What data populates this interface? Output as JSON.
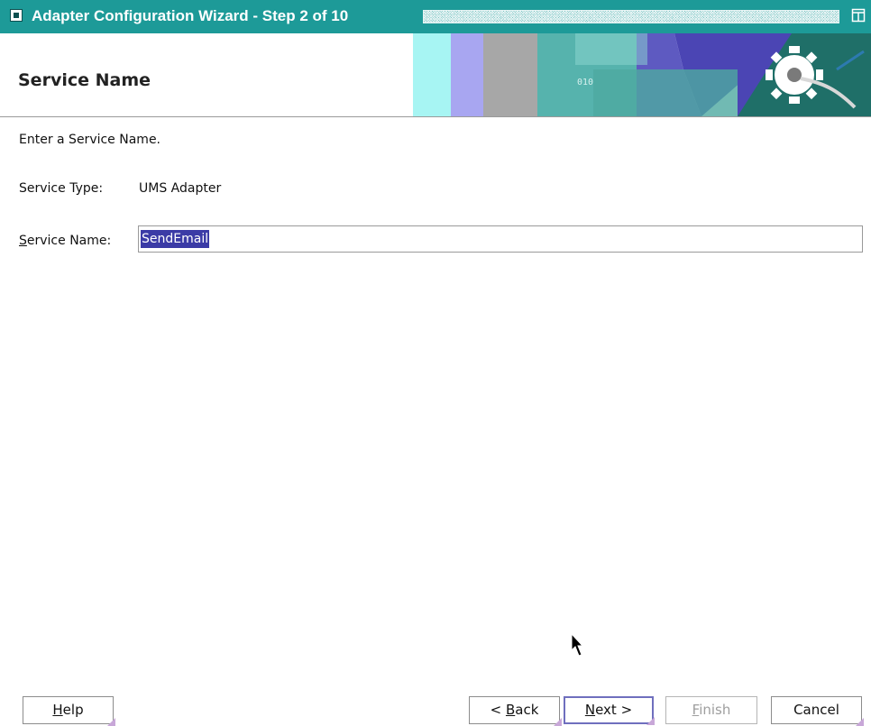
{
  "window": {
    "title": "Adapter Configuration Wizard - Step 2 of 10"
  },
  "header": {
    "page_title": "Service Name",
    "banner_text": "010"
  },
  "content": {
    "instruction": "Enter a Service Name.",
    "service_type": {
      "label": "Service Type:",
      "value": "UMS Adapter"
    },
    "service_name": {
      "label_mnemonic": "S",
      "label_rest": "ervice Name:",
      "value": "SendEmail"
    }
  },
  "buttons": {
    "help": {
      "mnemonic": "H",
      "rest": "elp"
    },
    "back": {
      "prefix": "< ",
      "mnemonic": "B",
      "rest": "ack"
    },
    "next": {
      "mnemonic": "N",
      "rest": "ext >"
    },
    "finish": {
      "mnemonic": "F",
      "rest": "inish"
    },
    "cancel": {
      "label": "Cancel"
    }
  },
  "colors": {
    "titlebar": "#1d9a98",
    "selection": "#3b3ba6",
    "default_button_border": "#6f6fbe"
  }
}
